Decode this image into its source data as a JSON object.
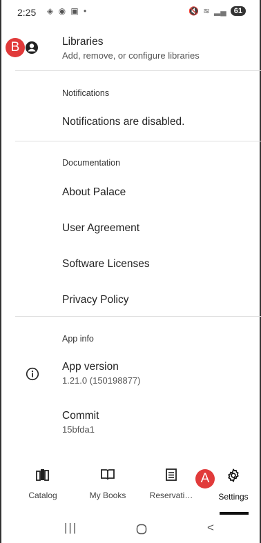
{
  "status": {
    "time": "2:25",
    "battery": "61"
  },
  "libraries": {
    "title": "Libraries",
    "subtitle": "Add, remove, or configure libraries"
  },
  "notifications": {
    "section": "Notifications",
    "text": "Notifications are disabled."
  },
  "documentation": {
    "section": "Documentation",
    "items": [
      "About Palace",
      "User Agreement",
      "Software Licenses",
      "Privacy Policy"
    ]
  },
  "app_info": {
    "section": "App info",
    "version_title": "App version",
    "version_value": "1.21.0 (150198877)",
    "commit_title": "Commit",
    "commit_value": "15bfda1"
  },
  "nav": {
    "items": [
      {
        "label": "Catalog",
        "icon": "catalog-icon"
      },
      {
        "label": "My Books",
        "icon": "book-icon"
      },
      {
        "label": "Reservati…",
        "icon": "reservations-icon"
      },
      {
        "label": "Settings",
        "icon": "gear-icon"
      }
    ]
  },
  "annotations": {
    "a": "A",
    "b": "B"
  },
  "colors": {
    "badge": "#e13a3a",
    "text": "#222222"
  }
}
